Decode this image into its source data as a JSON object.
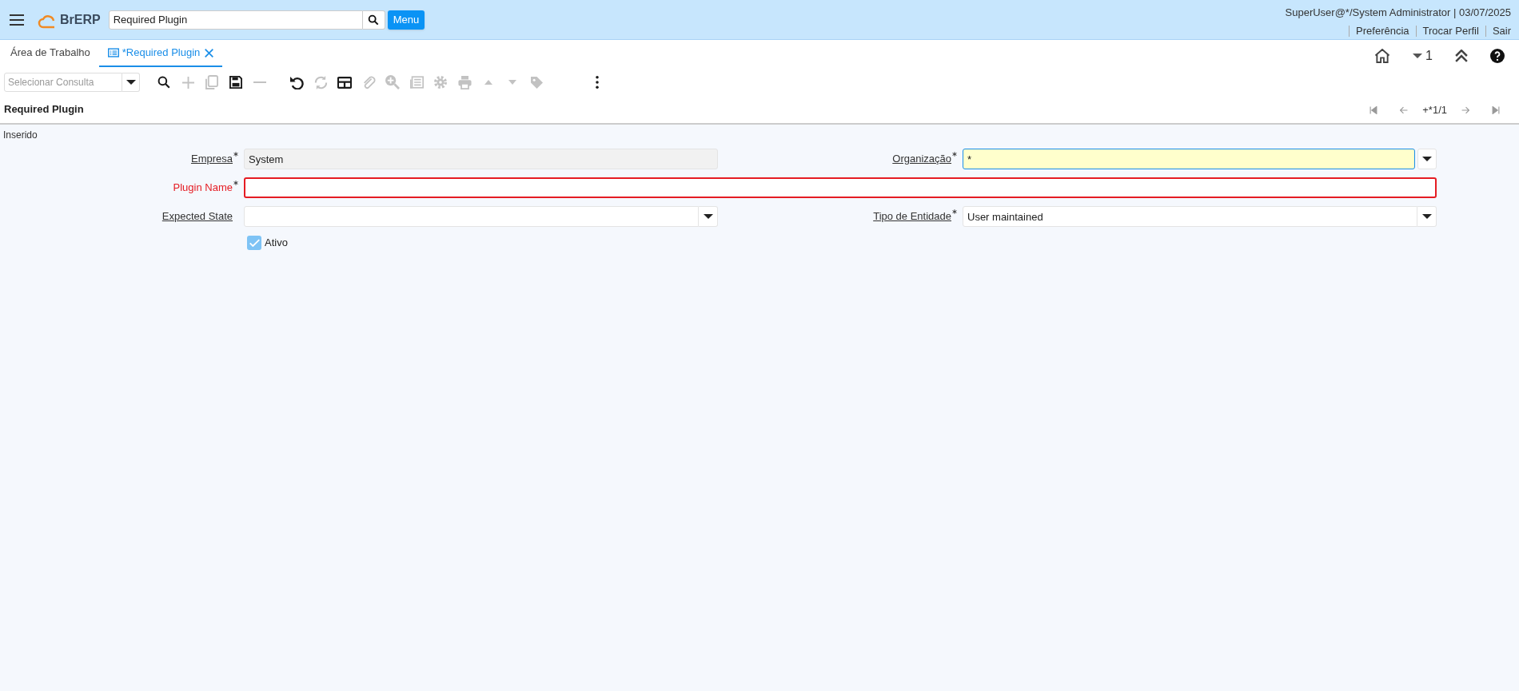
{
  "header": {
    "logo_text": "BrERP",
    "search_value": "Required Plugin",
    "menu_button": "Menu",
    "user_info": "SuperUser@*/System Administrator | 03/07/2025",
    "links": [
      "Preferência",
      "Trocar Perfil",
      "Sair"
    ]
  },
  "tabs": [
    {
      "label": "Área de Trabalho",
      "selected": false,
      "closable": false
    },
    {
      "label": "*Required Plugin",
      "selected": true,
      "closable": true
    }
  ],
  "tab_actions": {
    "count": "1"
  },
  "toolbar": {
    "query_placeholder": "Selecionar Consulta",
    "buttons": [
      {
        "kind": "search",
        "disabled": false
      },
      {
        "kind": "new",
        "disabled": true
      },
      {
        "kind": "copy",
        "disabled": true
      },
      {
        "kind": "save",
        "disabled": false
      },
      {
        "kind": "delete",
        "disabled": true
      },
      {
        "kind": "undo",
        "disabled": false
      },
      {
        "kind": "refresh",
        "disabled": true
      },
      {
        "kind": "grid",
        "disabled": false
      },
      {
        "kind": "attach",
        "disabled": true
      },
      {
        "kind": "zoom",
        "disabled": true
      },
      {
        "kind": "report",
        "disabled": true
      },
      {
        "kind": "gear",
        "disabled": true
      },
      {
        "kind": "print",
        "disabled": true
      },
      {
        "kind": "up",
        "disabled": true
      },
      {
        "kind": "down",
        "disabled": true
      },
      {
        "kind": "tag",
        "disabled": true
      },
      {
        "kind": "more",
        "disabled": false
      }
    ]
  },
  "panel": {
    "title": "Required Plugin",
    "record": "+*1/1",
    "status": "Inserido"
  },
  "fields": [
    {
      "kind": "text",
      "label": "Empresa",
      "value": "System",
      "mandatory": true,
      "readonly": true,
      "error": false,
      "focused": false,
      "wide": false
    },
    {
      "kind": "select",
      "label": "Organização",
      "value": "*",
      "mandatory": true,
      "readonly": false,
      "error": false,
      "focused": true,
      "wide": false
    },
    {
      "kind": "text",
      "label": "Plugin Name",
      "mandatory": true,
      "readonly": false,
      "error": true,
      "focused": false,
      "wide": true
    },
    {
      "kind": "select",
      "label": "Expected State",
      "mandatory": false,
      "readonly": false,
      "error": false,
      "focused": false,
      "wide": false
    },
    {
      "kind": "select",
      "label": "Tipo de Entidade",
      "value": "User maintained",
      "mandatory": true,
      "readonly": false,
      "error": false,
      "focused": false,
      "wide": false
    },
    {
      "kind": "checkbox",
      "label": "Ativo",
      "checked": true
    }
  ]
}
